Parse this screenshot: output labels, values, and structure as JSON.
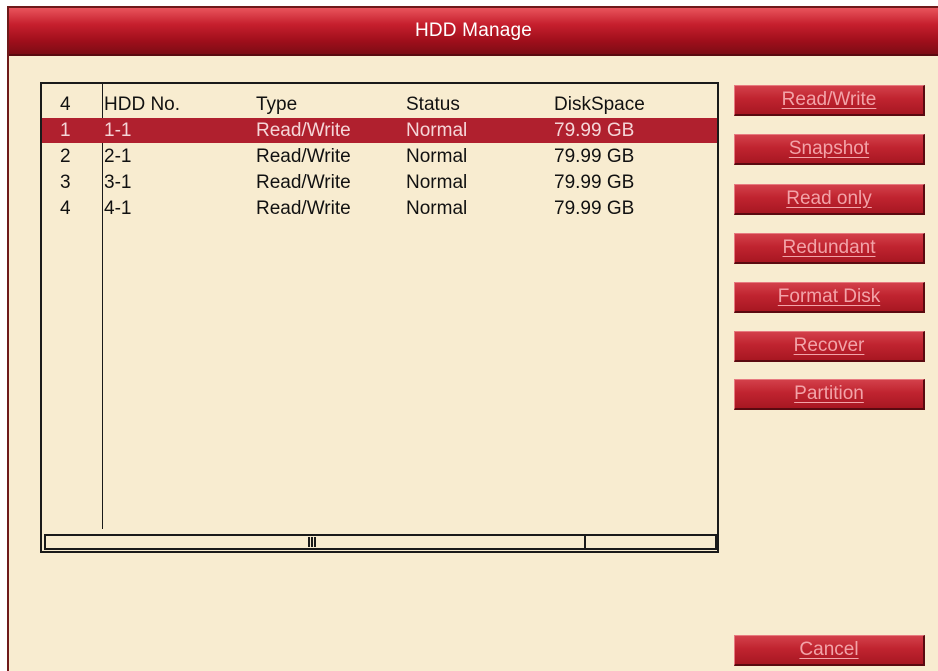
{
  "window": {
    "title": "HDD Manage"
  },
  "table": {
    "columns": {
      "index": "4",
      "hdd_no": "HDD No.",
      "type": "Type",
      "status": "Status",
      "disk_space": "DiskSpace"
    },
    "rows": [
      {
        "index": "1",
        "hdd_no": "1-1",
        "type": "Read/Write",
        "status": "Normal",
        "disk_space": "79.99 GB",
        "selected": true
      },
      {
        "index": "2",
        "hdd_no": "2-1",
        "type": "Read/Write",
        "status": "Normal",
        "disk_space": "79.99 GB",
        "selected": false
      },
      {
        "index": "3",
        "hdd_no": "3-1",
        "type": "Read/Write",
        "status": "Normal",
        "disk_space": "79.99 GB",
        "selected": false
      },
      {
        "index": "4",
        "hdd_no": "4-1",
        "type": "Read/Write",
        "status": "Normal",
        "disk_space": "79.99 GB",
        "selected": false
      }
    ]
  },
  "buttons": {
    "read_write": "Read/Write",
    "snapshot": "Snapshot",
    "read_only": "Read only",
    "redundant": "Redundant",
    "format_disk": "Format Disk",
    "recover": "Recover",
    "partition": "Partition",
    "cancel": "Cancel"
  },
  "colors": {
    "background": "#f8ecd0",
    "titlebar": "#a10f1c",
    "selected_row": "#b0202e",
    "button": "#c02430",
    "button_text": "#f2a3a8"
  }
}
